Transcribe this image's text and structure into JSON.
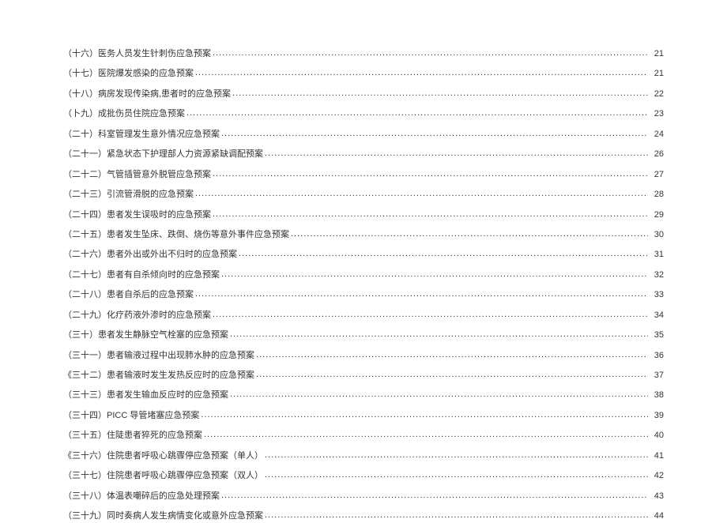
{
  "toc_entries": [
    {
      "title": "（十六）医务人员发生针刺伤应急预案",
      "page": "21"
    },
    {
      "title": "（十七）医院爆发感染的应急预案",
      "page": "21"
    },
    {
      "title": "（十八）病房发现传染病,患者时的应急预案",
      "page": "22"
    },
    {
      "title": "（卜九）成批伤员住院应急预案",
      "page": "23"
    },
    {
      "title": "（二十）科室管理发生意外情况应急预案",
      "page": "24"
    },
    {
      "title": "（二十一）紧急状态下护理部人力资源紧缺调配预案",
      "page": "26"
    },
    {
      "title": "（二十二）气管插管意外脱管应急预案",
      "page": "27"
    },
    {
      "title": "（二十三）引流管滑脱的应急预案",
      "page": "28"
    },
    {
      "title": "（二十四）患者发生误吸时的应急预案",
      "page": "29"
    },
    {
      "title": "（二十五）患者发生坠床、跌倒、烧伤等意外事件应急预案",
      "page": "30"
    },
    {
      "title": "（二十六）患者外出或外出不归时的应急预案",
      "page": "31"
    },
    {
      "title": "（二十七）患者有自杀倾向时的应急预案",
      "page": "32"
    },
    {
      "title": "（二十八）患者自杀后的应急预案",
      "page": "33"
    },
    {
      "title": "（二十九）化疗药液外渗时的应急预案",
      "page": "34"
    },
    {
      "title": "（三十）患者发生静脉空气栓塞的应急预案",
      "page": "35"
    },
    {
      "title": "（三十一）患者输液过程中出现肺水肿的应急预案",
      "page": "36"
    },
    {
      "title": "《三十二）患者输液时发生发热反应时的应急预案",
      "page": "37"
    },
    {
      "title": "（三十三）患者发生输血反应时的应急预案",
      "page": "38"
    },
    {
      "title": "（三十四）PICC 导管堵塞应急预案",
      "page": "39"
    },
    {
      "title": "（三十五）住陡患者猝死的应急预案",
      "page": "40"
    },
    {
      "title": "《三十六）住院患者呼吸心跳骤停应急预案（单人）",
      "page": "41"
    },
    {
      "title": "（三十七）住院患者呼吸心跳骤停应急预案（双人）",
      "page": "42"
    },
    {
      "title": "（三十八）体温表嘲碎后的应急处理预案",
      "page": "43"
    },
    {
      "title": "（三十九）同时奏病人发生病情变化或意外应急预案",
      "page": "44"
    }
  ]
}
